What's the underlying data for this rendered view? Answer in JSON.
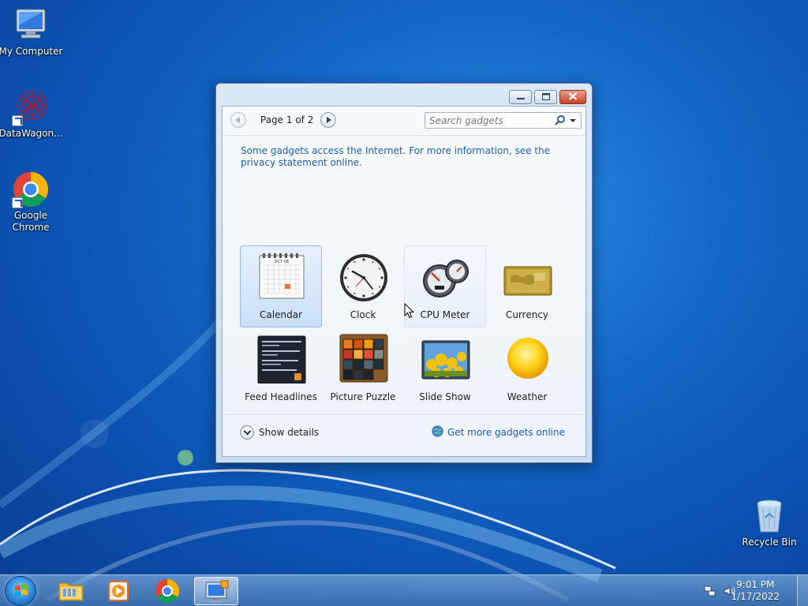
{
  "desktop": {
    "icons": [
      {
        "label": "My Computer",
        "icon": "computer-icon"
      },
      {
        "label": "DataWagon...",
        "icon": "datawagon-icon"
      },
      {
        "label": "Google Chrome",
        "icon": "chrome-icon"
      },
      {
        "label": "Recycle Bin",
        "icon": "recycle-bin-icon"
      }
    ]
  },
  "gadget_window": {
    "caption": {
      "minimize": "minimize-icon",
      "restore": "restore-icon",
      "close": "close-icon"
    },
    "pager": {
      "label": "Page 1 of 2"
    },
    "search": {
      "placeholder": "Search gadgets"
    },
    "notice": "Some gadgets access the Internet.  For more information, see the privacy statement online.",
    "gadgets": [
      {
        "label": "Calendar",
        "icon": "calendar-icon",
        "state": "selected",
        "month": "OCT 06"
      },
      {
        "label": "Clock",
        "icon": "clock-icon",
        "state": "normal"
      },
      {
        "label": "CPU Meter",
        "icon": "cpu-meter-icon",
        "state": "hover"
      },
      {
        "label": "Currency",
        "icon": "currency-icon",
        "state": "normal"
      },
      {
        "label": "Feed Headlines",
        "icon": "feed-headlines-icon",
        "state": "normal"
      },
      {
        "label": "Picture Puzzle",
        "icon": "picture-puzzle-icon",
        "state": "normal"
      },
      {
        "label": "Slide Show",
        "icon": "slide-show-icon",
        "state": "normal"
      },
      {
        "label": "Weather",
        "icon": "weather-icon",
        "state": "normal"
      }
    ],
    "footer": {
      "show_details": "Show details",
      "get_more": "Get more gadgets online"
    }
  },
  "taskbar": {
    "items": [
      {
        "icon": "start-orb-icon"
      },
      {
        "icon": "file-explorer-icon"
      },
      {
        "icon": "media-player-icon"
      },
      {
        "icon": "chrome-icon"
      },
      {
        "icon": "desktop-gadgets-icon",
        "active": true
      }
    ],
    "tray": {
      "time": "9:01 PM",
      "date": "1/17/2022"
    }
  },
  "colors": {
    "accent_link": "#1f5fae",
    "selected_bg": "#c9e0f7",
    "wallpaper": "#1467c8"
  }
}
